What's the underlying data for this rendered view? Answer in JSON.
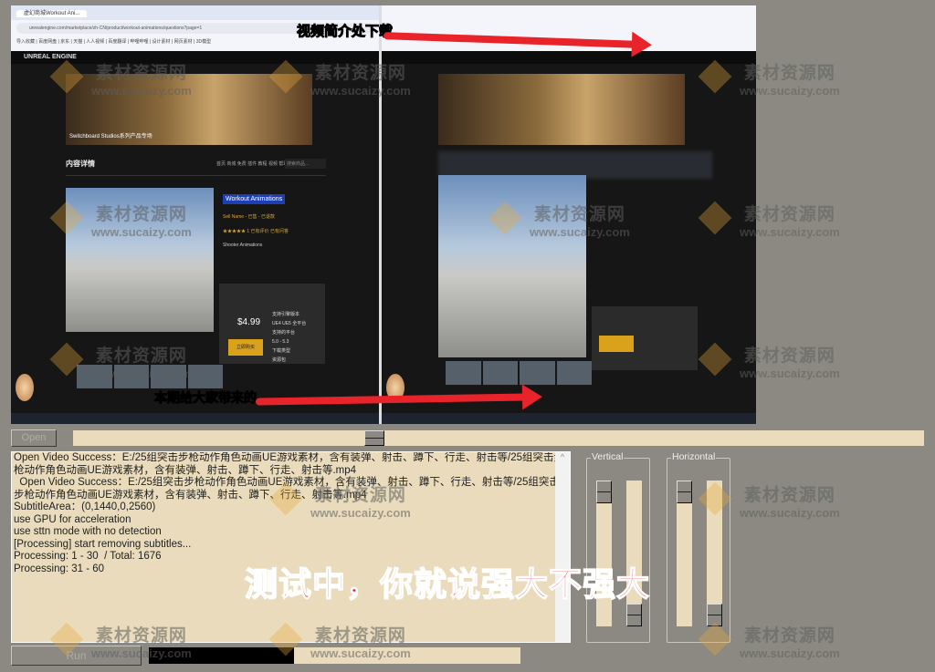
{
  "preview": {
    "browser_tab": "虚幻商城Workout Ani...",
    "url": "unrealengine.com/marketplace/zh-CN/product/workout-animations/questions?page=1",
    "bookmarks": "导入收藏 | 百度网盘 | 京东 | 天猫 | 人人视频 | 百度翻译 | 哔哩哔哩 | 设计素材 | 网页素材 | 3D模型",
    "ue_nav": "UNREAL ENGINE",
    "banner_title": "Switchboard Studios系列产品专场",
    "section_title": "内容详情",
    "filters": "首页  商城  免费  插件  教程  视频  帮助",
    "search_placeholder": "搜索商品...",
    "product_name": "Workout Animations",
    "product_seller": "Sell Name - 已售 - 已退款",
    "product_rating": "★★★★★ 1  已有评价  已有问答",
    "product_desc": "Shooter Animations",
    "price": "$4.99",
    "buy_label": "立即购买",
    "buy_list": [
      "支持引擎版本",
      "UE4 UE5 全平台",
      "支持的平台",
      "5.0 - 5.3",
      "下载类型",
      "资源包"
    ],
    "caption_top": "视频简介处下载",
    "caption_bottom": "本期给大家带来的"
  },
  "controls": {
    "open_label": "Open",
    "run_label": "Run",
    "seek_position": 0.35,
    "progress": 0.39
  },
  "log": {
    "lines": [
      "Open Video Success：E:/25组突击步枪动作角色动画UE游戏素材，含有装弹、射击、蹲下、行走、射击等/25组突击步枪动作角色动画UE游戏素材，含有装弹、射击、蹲下、行走、射击等.mp4",
      "  Open Video Success：E:/25组突击步枪动作角色动画UE游戏素材，含有装弹、射击、蹲下、行走、射击等/25组突击步枪动作角色动画UE游戏素材，含有装弹、射击、蹲下、行走、射击等.mp4",
      "SubtitleArea：(0,1440,0,2560)",
      "use GPU for acceleration",
      "use sttn mode with no detection",
      "[Processing] start removing subtitles...",
      "Processing: 1 - 30  / Total: 1676",
      "Processing: 31 - 60"
    ]
  },
  "vertical": {
    "label": "Vertical",
    "slider1": 0.0,
    "slider2": 1.0
  },
  "horizontal": {
    "label": "Horizontal",
    "slider1": 0.0,
    "slider2": 1.0
  },
  "overlay_text": "测试中，你就说强大不强大",
  "watermark": {
    "cn": "素材资源网",
    "url": "www.sucaizy.com"
  },
  "colors": {
    "background": "#8b8981",
    "panel": "#e9dbbb",
    "arrow": "#e8232a",
    "overlay": "#e8141c",
    "caption": "#ffe600"
  }
}
